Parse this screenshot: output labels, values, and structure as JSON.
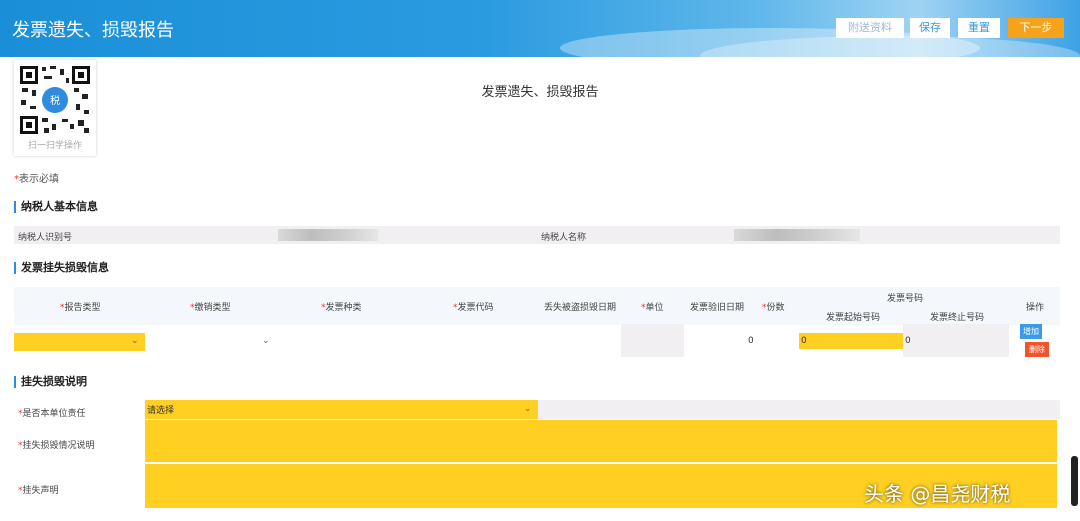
{
  "header": {
    "title": "发票遗失、损毁报告",
    "buttons": {
      "attach": "附送资料",
      "save": "保存",
      "reset": "重置",
      "next": "下一步"
    }
  },
  "qr": {
    "caption": "扫一扫学操作"
  },
  "document_title": "发票遗失、损毁报告",
  "required_note": {
    "star": "*",
    "text": "表示必填"
  },
  "sections": {
    "taxpayer": "纳税人基本信息",
    "invoice_info": "发票挂失损毁信息",
    "description": "挂失损毁说明"
  },
  "taxpayer": {
    "id_label": "纳税人识别号",
    "name_label": "纳税人名称"
  },
  "table": {
    "headers": {
      "report_type": "报告类型",
      "cancel_type": "缴销类型",
      "invoice_kind": "发票种类",
      "invoice_code": "发票代码",
      "lost_date": "丢失被盗损毁日期",
      "unit": "单位",
      "issue_date": "发票验旧日期",
      "copies": "份数",
      "invoice_number": "发票号码",
      "start_number": "发票起始号码",
      "end_number": "发票终止号码",
      "operation": "操作"
    },
    "row": {
      "copies": "0",
      "start_number": "0",
      "end_number": "0"
    },
    "add_label": "增加",
    "delete_label": "删除"
  },
  "description": {
    "responsibility_label": "是否本单位责任",
    "responsibility_value": "请选择",
    "situation_label": "挂失损毁情况说明",
    "statement_label": "挂失声明"
  },
  "watermark": "头条 @昌尧财税",
  "colors": {
    "header": "#1a8fd8",
    "required": "#ffcf22",
    "next_button": "#f7a21b",
    "delete_button": "#f0532d"
  }
}
